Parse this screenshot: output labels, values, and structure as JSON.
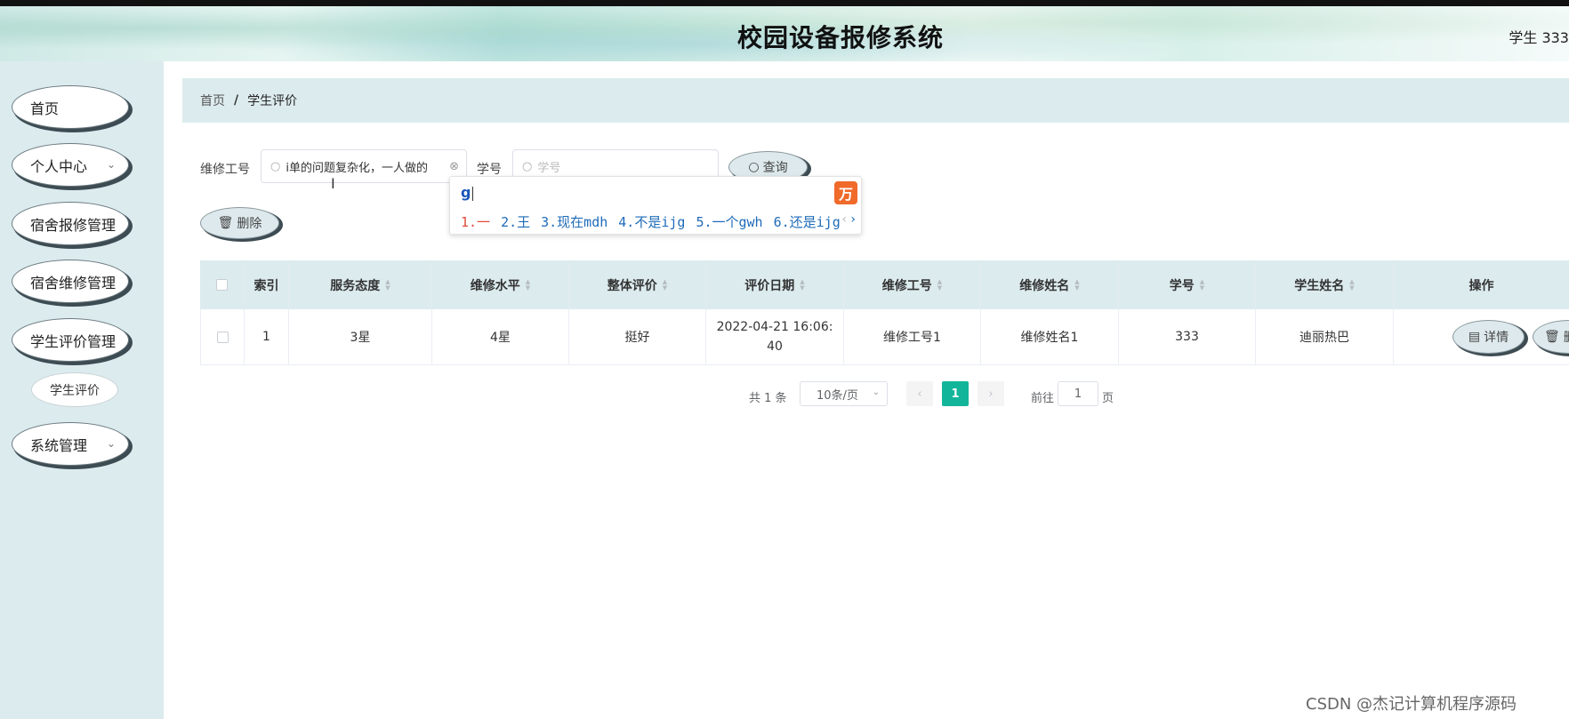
{
  "header": {
    "title": "校园设备报修系统",
    "user": "学生 333"
  },
  "sidebar": {
    "items": [
      {
        "label": "首页",
        "has_arrow": false
      },
      {
        "label": "个人中心",
        "has_arrow": true
      },
      {
        "label": "宿舍报修管理",
        "has_arrow": false
      },
      {
        "label": "宿舍维修管理",
        "has_arrow": false
      },
      {
        "label": "学生评价管理",
        "has_arrow": false
      },
      {
        "label": "系统管理",
        "has_arrow": true
      }
    ],
    "sub_item": "学生评价"
  },
  "breadcrumb": {
    "home": "首页",
    "sep": "/",
    "current": "学生评价"
  },
  "search": {
    "field1_label": "维修工号",
    "field1_value": "i单的问题复杂化，一人做的",
    "field2_label": "学号",
    "field2_placeholder": "学号",
    "query_button": "查询",
    "delete_button": "删除"
  },
  "ime": {
    "composition": "g",
    "candidates": [
      "1.一",
      "2.王",
      "3.现在mdh",
      "4.不是ijg",
      "5.一个gwh",
      "6.还是ijg"
    ],
    "logo": "万"
  },
  "table": {
    "columns": [
      "索引",
      "服务态度",
      "维修水平",
      "整体评价",
      "评价日期",
      "维修工号",
      "维修姓名",
      "学号",
      "学生姓名",
      "操作"
    ],
    "rows": [
      {
        "index": "1",
        "service": "3星",
        "skill": "4星",
        "overall": "挺好",
        "date": "2022-04-21 16:06:40",
        "worker_id": "维修工号1",
        "worker_name": "维修姓名1",
        "student_id": "333",
        "student_name": "迪丽热巴",
        "detail_button": "详情",
        "delete_button": "删除"
      }
    ]
  },
  "pagination": {
    "total": "共 1 条",
    "page_size": "10条/页",
    "current_page": "1",
    "goto_label": "前往",
    "goto_value": "1",
    "page_unit": "页"
  },
  "watermark": "CSDN @杰记计算机程序源码",
  "colors": {
    "accent": "#13b59a",
    "panel": "#dcebee",
    "ime_red": "#e04b3a",
    "ime_blue": "#1e6bb8"
  }
}
